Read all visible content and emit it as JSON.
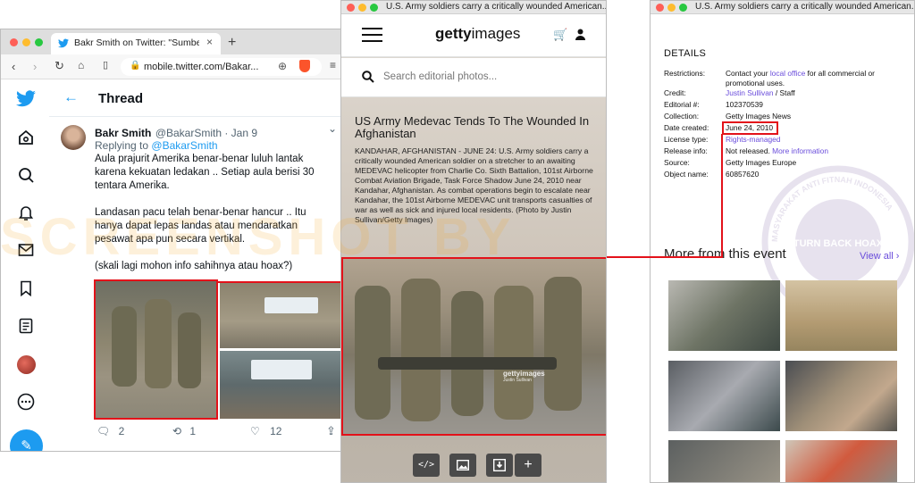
{
  "twitter": {
    "tab_title": "Bakr Smith on Twitter: \"Sumber da",
    "url": "mobile.twitter.com/Bakar...",
    "header": "Thread",
    "author_name": "Bakr Smith",
    "author_handle": "@BakarSmith · Jan 9",
    "replying_prefix": "Replying to",
    "replying_handle": "@BakarSmith",
    "tweet_p1": "Aula prajurit Amerika benar-benar luluh lantak karena kekuatan ledakan .. Setiap aula berisi 30 tentara Amerika.",
    "tweet_p2": "Landasan pacu telah benar-benar hancur .. Itu hanya dapat lepas landas atau mendaratkan pesawat apa pun secara vertikal.",
    "tweet_p3": "(skali lagi mohon info sahihnya atau hoax?)",
    "reply_count": "2",
    "retweet_count": "1",
    "like_count": "12"
  },
  "getty": {
    "window_title": "U.S. Army soldiers carry a critically wounded American...",
    "logo_bold": "getty",
    "logo_light": "images",
    "search_placeholder": "Search editorial photos...",
    "headline": "US Army Medevac Tends To The Wounded In Afghanistan",
    "caption": "KANDAHAR, AFGHANISTAN - JUNE 24: U.S. Army soldiers carry a critically wounded American soldier on a stretcher to an awaiting MEDEVAC helicopter from Charlie Co. Sixth Battalion, 101st Airborne Combat Aviation Brigade, Task Force Shadow June 24, 2010 near Kandahar, Afghanistan. As combat operations begin to escalate near Kandahar, the 101st Airborne MEDEVAC unit transports casualties of war as well as sick and injured local residents. (Photo by Justin Sullivan/Getty Images)",
    "watermark": "gettyimages",
    "watermark_credit": "Justin Sullivan"
  },
  "details": {
    "window_title": "U.S. Army soldiers carry a critically wounded American...",
    "heading": "DETAILS",
    "restrictions_label": "Restrictions:",
    "restrictions_pre": "Contact your ",
    "restrictions_link": "local office",
    "restrictions_post": " for all commercial or promotional uses.",
    "credit_label": "Credit:",
    "credit_link": "Justin Sullivan",
    "credit_post": " / Staff",
    "editorial_label": "Editorial #:",
    "editorial_value": "102370539",
    "collection_label": "Collection:",
    "collection_value": "Getty Images News",
    "date_label": "Date created:",
    "date_value": "June 24, 2010",
    "license_label": "License type:",
    "license_value": "Rights-managed",
    "release_label": "Release info:",
    "release_pre": "Not released. ",
    "release_link": "More information",
    "source_label": "Source:",
    "source_value": "Getty Images Europe",
    "object_label": "Object name:",
    "object_value": "60857620",
    "more_heading": "More from this event",
    "view_all": "View all"
  },
  "overlay": {
    "watermark_text": "SCREENSHOT BY",
    "stamp_top": "MASYARAKAT ANTI FITNAH INDONESIA",
    "stamp_center": "TURN BACK HOAX"
  },
  "colors": {
    "twitter_blue": "#1d9bf0",
    "highlight_red": "#e3121a",
    "getty_link": "#6a4ddb"
  }
}
